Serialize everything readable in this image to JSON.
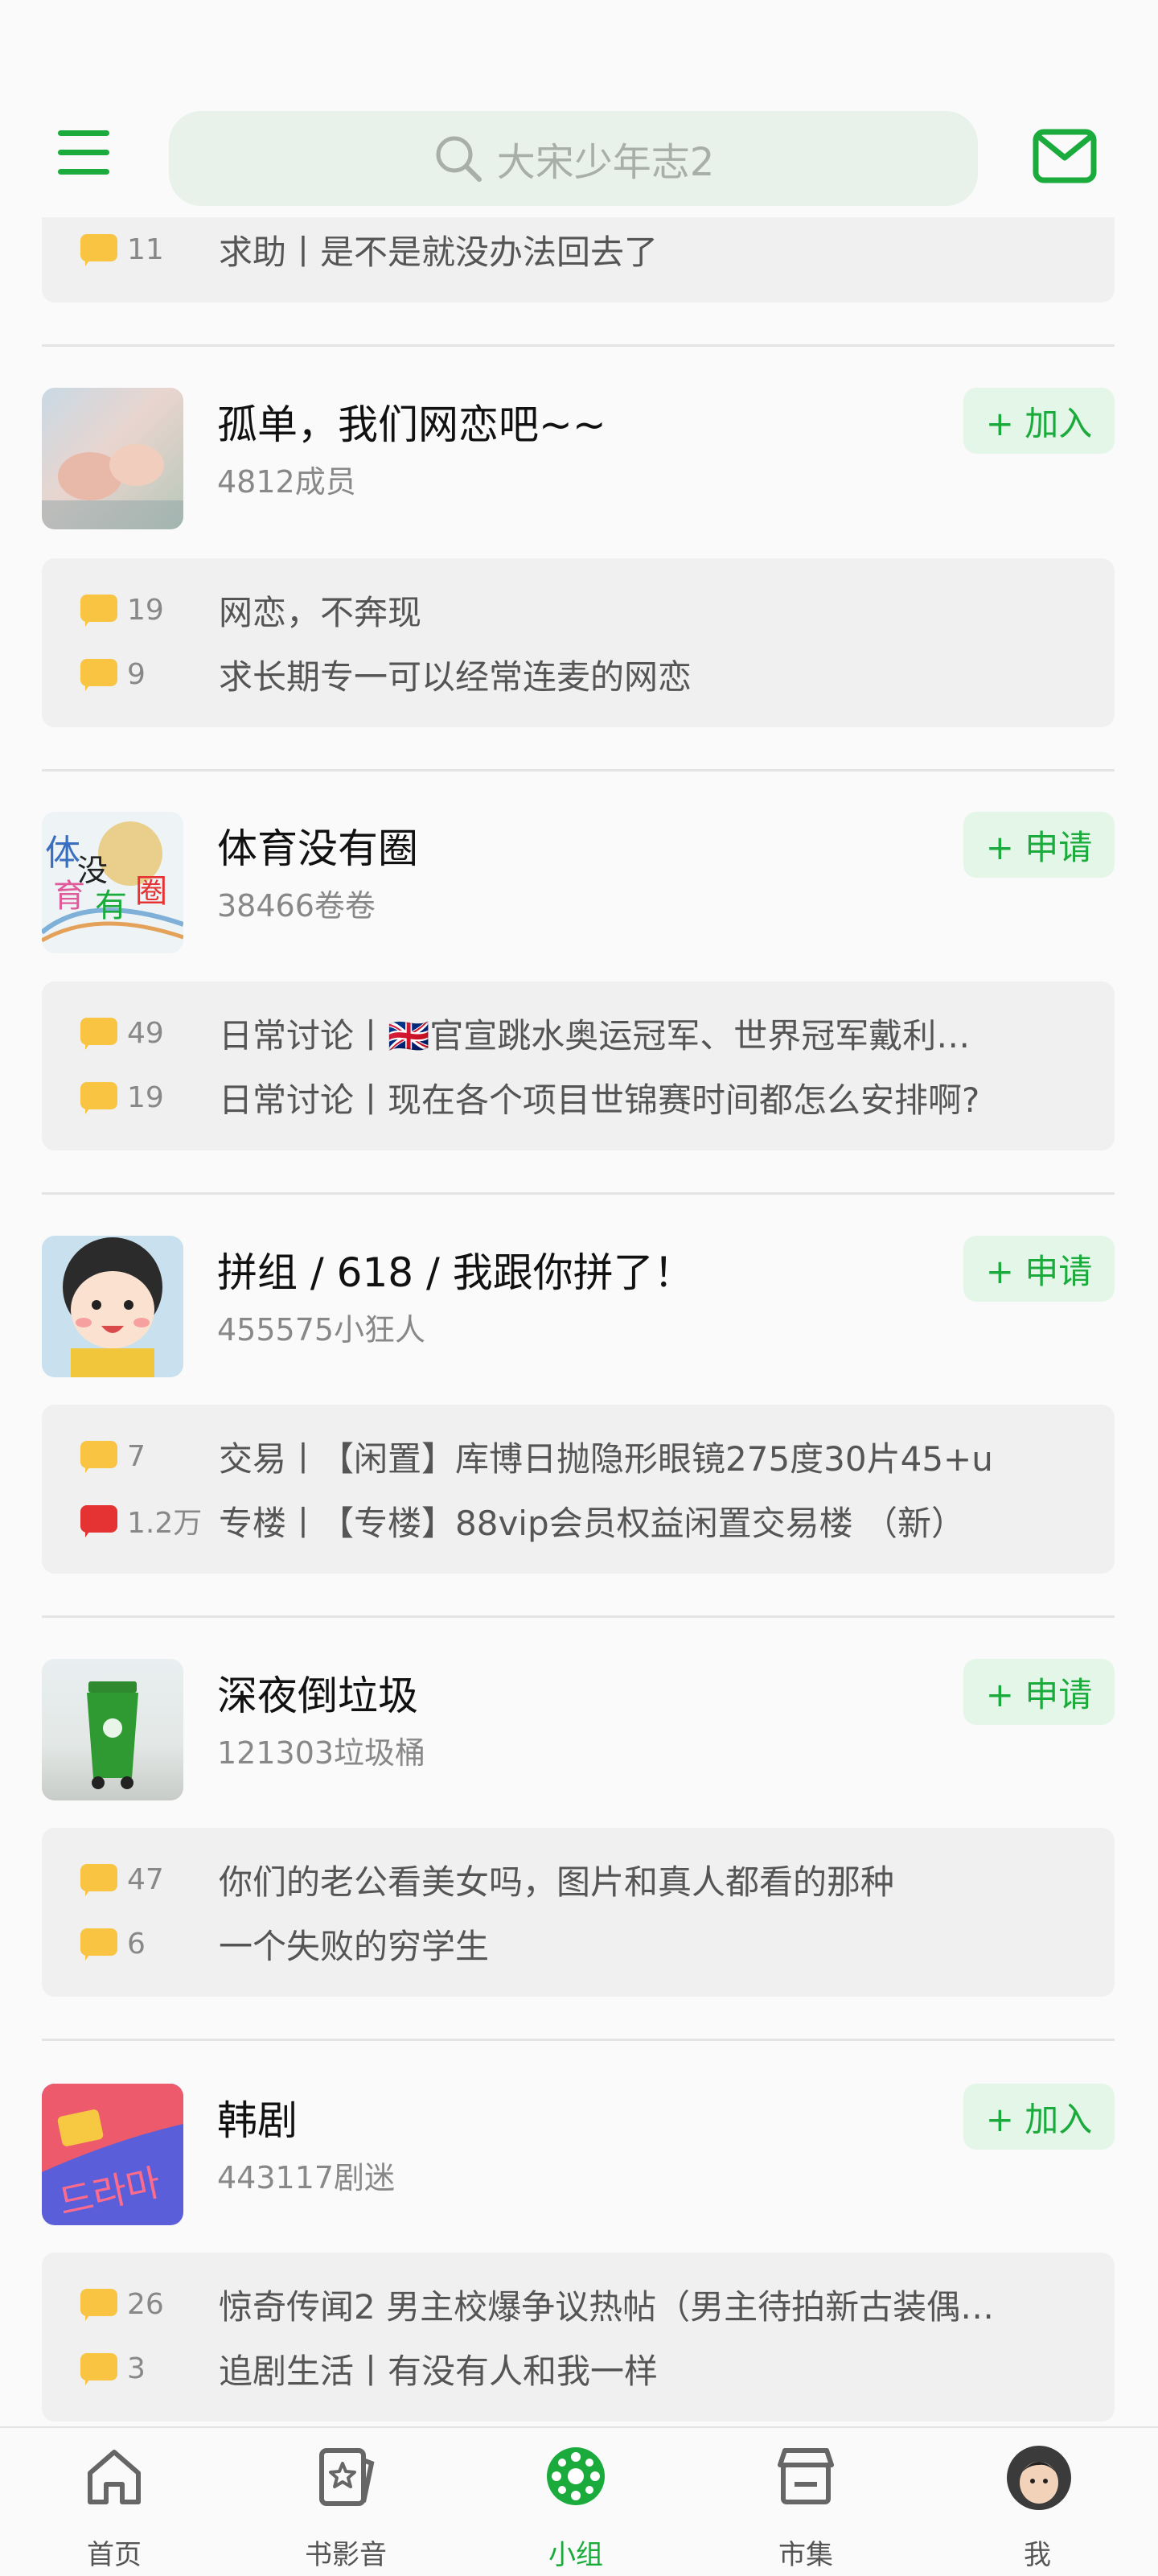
{
  "header": {
    "search_placeholder": "大宋少年志2",
    "icons": {
      "menu": "menu-icon",
      "search": "search-icon",
      "mail": "mail-icon"
    },
    "accent_color": "#1aab3c"
  },
  "top_partial_post": {
    "count": "11",
    "text": "求助丨是不是就没办法回去了"
  },
  "groups": [
    {
      "name": "孤单，我们网恋吧~~",
      "members": "4812成员",
      "action": "+ 加入",
      "posts": [
        {
          "count": "19",
          "text": "网恋，不奔现"
        },
        {
          "count": "9",
          "text": "求长期专一可以经常连麦的网恋"
        }
      ]
    },
    {
      "name": "体育没有圈",
      "members": "38466卷卷",
      "action": "+ 申请",
      "avatar_text": {
        "t1": "体",
        "t2": "育",
        "t3": "没",
        "t4": "有",
        "t5": "圈"
      },
      "posts": [
        {
          "count": "49",
          "text": "日常讨论丨🇬🇧官宣跳水奥运冠军、世界冠军戴利…"
        },
        {
          "count": "19",
          "text": "日常讨论丨现在各个项目世锦赛时间都怎么安排啊?"
        }
      ]
    },
    {
      "name": "拼组 / 618 / 我跟你拼了！",
      "members": "455575小狂人",
      "action": "+ 申请",
      "posts": [
        {
          "count": "7",
          "text": "交易丨【闲置】库博日抛隐形眼镜275度30片45+u"
        },
        {
          "count": "1.2万",
          "text": "专楼丨【专楼】88vip会员权益闲置交易楼 （新）"
        }
      ]
    },
    {
      "name": "深夜倒垃圾",
      "members": "121303垃圾桶",
      "action": "+ 申请",
      "posts": [
        {
          "count": "47",
          "text": "你们的老公看美女吗，图片和真人都看的那种"
        },
        {
          "count": "6",
          "text": "一个失败的穷学生"
        }
      ]
    },
    {
      "name": "韩剧",
      "members": "443117剧迷",
      "action": "+ 加入",
      "avatar_text": "드라마",
      "posts": [
        {
          "count": "26",
          "text": "惊奇传闻2 男主校爆争议热帖（男主待拍新古装偶…"
        },
        {
          "count": "3",
          "text": "追剧生活丨有没有人和我一样"
        }
      ]
    }
  ],
  "tabbar": {
    "items": [
      {
        "label": "首页",
        "icon": "home-icon"
      },
      {
        "label": "书影音",
        "icon": "book-movie-music-icon"
      },
      {
        "label": "小组",
        "icon": "group-icon",
        "active": true
      },
      {
        "label": "市集",
        "icon": "market-icon"
      },
      {
        "label": "我",
        "icon": "user-avatar"
      }
    ]
  }
}
